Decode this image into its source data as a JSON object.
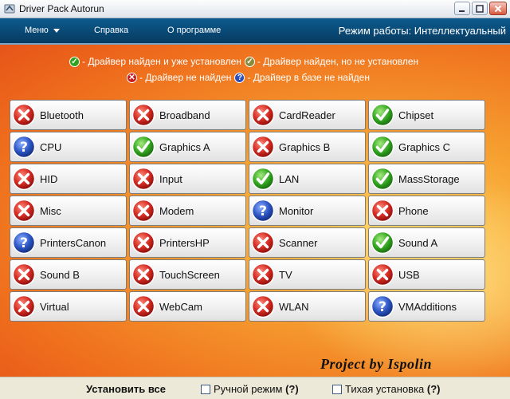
{
  "window": {
    "title": "Driver Pack Autorun"
  },
  "menu": {
    "items": [
      {
        "label": "Меню",
        "has_dropdown": true
      },
      {
        "label": "Справка",
        "has_dropdown": false
      },
      {
        "label": "О программе",
        "has_dropdown": false
      }
    ],
    "mode": "Режим работы: Интеллектуальный"
  },
  "legend": {
    "installed": "- Драйвер найден и уже установлен",
    "found_not_installed": "- Драйвер найден, но не установлен",
    "not_found": "- Драйвер не найден",
    "not_in_db": "- Драйвер в базе не найден"
  },
  "drivers": [
    {
      "name": "Bluetooth",
      "status": "not_found"
    },
    {
      "name": "Broadband",
      "status": "not_found"
    },
    {
      "name": "CardReader",
      "status": "not_found"
    },
    {
      "name": "Chipset",
      "status": "installed"
    },
    {
      "name": "CPU",
      "status": "not_in_db"
    },
    {
      "name": "Graphics A",
      "status": "installed"
    },
    {
      "name": "Graphics B",
      "status": "not_found"
    },
    {
      "name": "Graphics C",
      "status": "installed"
    },
    {
      "name": "HID",
      "status": "not_found"
    },
    {
      "name": "Input",
      "status": "not_found"
    },
    {
      "name": "LAN",
      "status": "installed"
    },
    {
      "name": "MassStorage",
      "status": "installed"
    },
    {
      "name": "Misc",
      "status": "not_found"
    },
    {
      "name": "Modem",
      "status": "not_found"
    },
    {
      "name": "Monitor",
      "status": "not_in_db"
    },
    {
      "name": "Phone",
      "status": "not_found"
    },
    {
      "name": "PrintersCanon",
      "status": "not_in_db"
    },
    {
      "name": "PrintersHP",
      "status": "not_found"
    },
    {
      "name": "Scanner",
      "status": "not_found"
    },
    {
      "name": "Sound A",
      "status": "installed"
    },
    {
      "name": "Sound B",
      "status": "not_found"
    },
    {
      "name": "TouchScreen",
      "status": "not_found"
    },
    {
      "name": "TV",
      "status": "not_found"
    },
    {
      "name": "USB",
      "status": "not_found"
    },
    {
      "name": "Virtual",
      "status": "not_found"
    },
    {
      "name": "WebCam",
      "status": "not_found"
    },
    {
      "name": "WLAN",
      "status": "not_found"
    },
    {
      "name": "VMAdditions",
      "status": "not_in_db"
    }
  ],
  "credit": "Project by Ispolin",
  "bottom": {
    "install_all": "Установить все",
    "manual_mode": "Ручной режим",
    "manual_mode_help": "(?)",
    "manual_mode_checked": false,
    "silent_install": "Тихая установка",
    "silent_install_help": "(?)",
    "silent_install_checked": false
  },
  "colors": {
    "installed": "#2ea31f",
    "found_not_installed": "#8a8a3a",
    "not_found": "#c81e1e",
    "not_in_db": "#2a4fb8",
    "menubar": "#0b4f7e"
  }
}
